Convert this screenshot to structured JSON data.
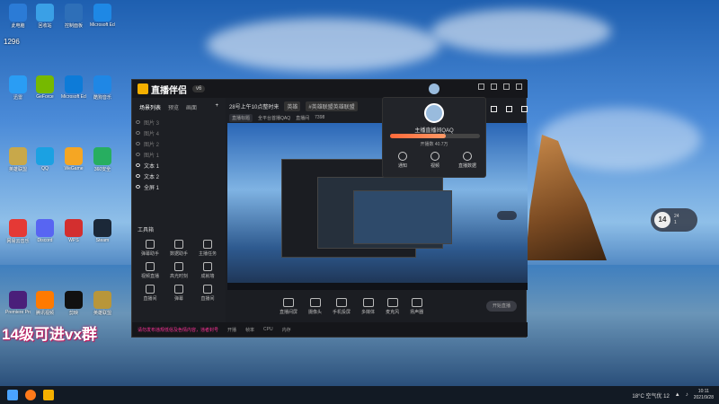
{
  "desktop": {
    "overlay_text": "14级可进vx群",
    "qq_text": "1296",
    "icons": [
      {
        "label": "此电脑",
        "color": "#2b7bd6"
      },
      {
        "label": "回收站",
        "color": "#3aa0e6"
      },
      {
        "label": "控制面板",
        "color": "#2e6fb8"
      },
      {
        "label": "Microsoft Edge",
        "color": "#1e88e5"
      },
      {
        "label": "迅雷",
        "color": "#2a9df4"
      },
      {
        "label": "GeForce",
        "color": "#76b900"
      },
      {
        "label": "Microsoft Edge",
        "color": "#0d7bd8"
      },
      {
        "label": "酷狗音乐",
        "color": "#1f87e5"
      },
      {
        "label": "英雄联盟",
        "color": "#c8a84a"
      },
      {
        "label": "QQ",
        "color": "#1ba1e2"
      },
      {
        "label": "WeGame",
        "color": "#f5a623"
      },
      {
        "label": "360安全",
        "color": "#27ae60"
      },
      {
        "label": "网易云音乐",
        "color": "#e53935"
      },
      {
        "label": "Discord",
        "color": "#5865f2"
      },
      {
        "label": "WPS",
        "color": "#d32f2f"
      },
      {
        "label": "Steam",
        "color": "#1b2838"
      },
      {
        "label": "Premiere Pro",
        "color": "#4a1f7a"
      },
      {
        "label": "腾讯视频",
        "color": "#ff7a00"
      },
      {
        "label": "剪映",
        "color": "#111111"
      },
      {
        "label": "英雄联盟",
        "color": "#b8963a"
      }
    ]
  },
  "app": {
    "name": "直播伴侣",
    "version": "v6",
    "sidebar_tabs": [
      "场景列表",
      "预览",
      "画面"
    ],
    "scenes": [
      {
        "label": "图片 3",
        "visible": false
      },
      {
        "label": "图片 4",
        "visible": false
      },
      {
        "label": "图片 2",
        "visible": false
      },
      {
        "label": "图片 1",
        "visible": false
      },
      {
        "label": "文本 1",
        "visible": true
      },
      {
        "label": "文本 2",
        "visible": true
      },
      {
        "label": "全屏 1",
        "visible": true
      }
    ],
    "tools_title": "工具箱",
    "tools": [
      "弹幕助手",
      "数据助手",
      "主播任务",
      "视频直播",
      "高光时刻",
      "成就墙",
      "直播间",
      "弹幕",
      "直播间"
    ],
    "preview_title": "28号上午10点整时来",
    "preview_tags": [
      "英雄",
      "#英雄联盟英雄联盟"
    ],
    "preview_sub": [
      "直播标题",
      "全平台首播QAQ",
      "直播间",
      "7398"
    ],
    "bottom_tools": [
      "直播间屏",
      "摄像头",
      "手机投屏",
      "多媒体",
      "麦克风",
      "扬声器"
    ],
    "live_button": "开始直播",
    "status_warning": "请勿发布违规低俗及色情内容，违者封号",
    "status_items": [
      "开播",
      "帧率",
      "CPU",
      "内存"
    ]
  },
  "popup": {
    "name": "主播直播间QAQ",
    "fans_label": "开播数 40.7万",
    "progress": 0.62,
    "actions": [
      "通知",
      "视频",
      "直播数据"
    ]
  },
  "weather_widget": {
    "temp": "14",
    "line1": "24",
    "line2": "1"
  },
  "taskbar": {
    "weather": "18°C 空气优 12",
    "time": "10:11",
    "date": "2021/9/28"
  }
}
